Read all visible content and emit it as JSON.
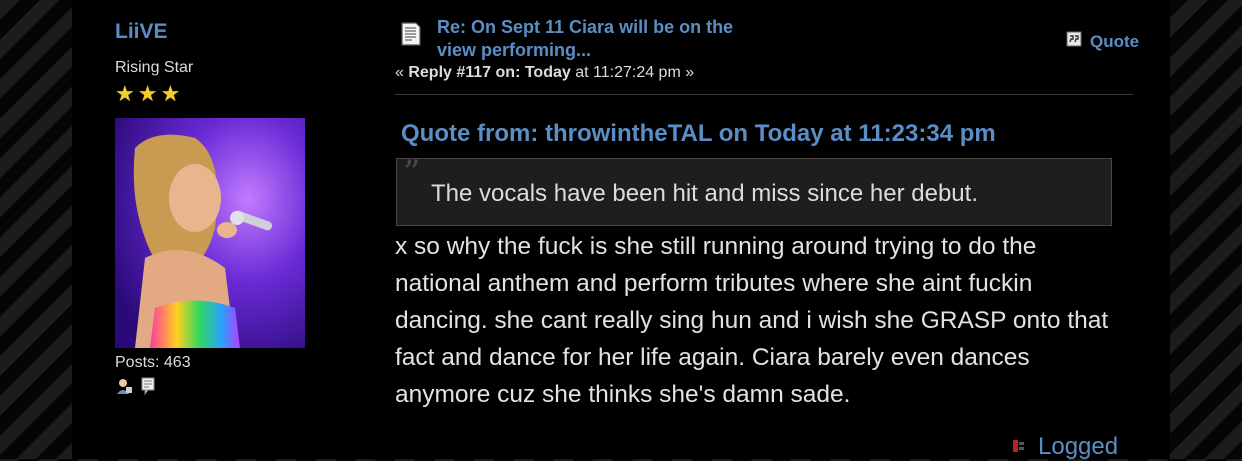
{
  "poster": {
    "username": "LiiVE",
    "rank": "Rising Star",
    "stars": 3,
    "posts_label": "Posts: 463"
  },
  "post": {
    "subject": "Re: On Sept 11 Ciara will be on the view performing...",
    "reply_prefix": "« ",
    "reply_number": "Reply #117 on:",
    "reply_day": "Today",
    "reply_time": " at 11:27:24 pm »",
    "quote_button": "Quote"
  },
  "quote": {
    "header": "Quote from: throwintheTAL on Today at 11:23:34 pm",
    "text": "The vocals have been hit and miss since her debut."
  },
  "body": {
    "text": "x so why the fuck is she still running around trying to do the national anthem and perform tributes where she aint fuckin dancing. she cant really sing hun and i wish she GRASP onto that fact and dance for her life again. Ciara barely even dances anymore cuz she thinks she's damn sade."
  },
  "footer": {
    "logged_label": "Logged"
  },
  "colors": {
    "link": "#5b8ec5",
    "text": "#dcdcdc",
    "background": "#000000",
    "quote_box": "#1e1e1e",
    "star": "#f2cf2a"
  },
  "icons": [
    "xx-topic-icon",
    "quote-icon",
    "profile-icon",
    "message-icon",
    "ip-icon"
  ]
}
